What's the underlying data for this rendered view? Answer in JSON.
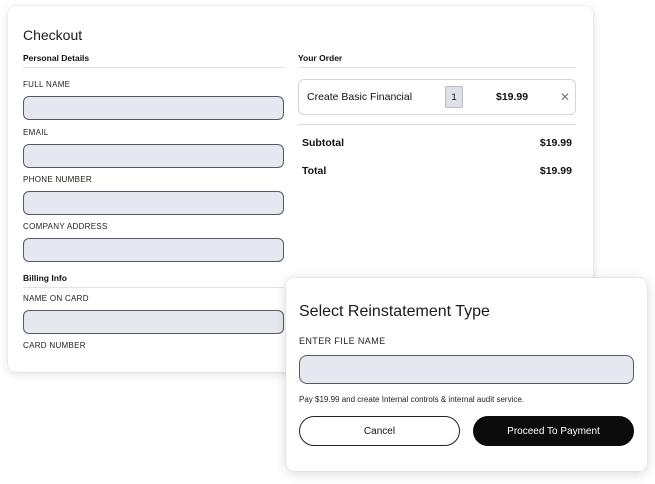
{
  "checkout": {
    "title": "Checkout",
    "personal_details": {
      "heading": "Personal Details",
      "full_name_label": "FULL NAME",
      "full_name_value": "",
      "email_label": "EMAIL",
      "email_value": "",
      "phone_label": "PHONE NUMBER",
      "phone_value": "",
      "company_address_label": "COMPANY ADDRESS",
      "company_address_value": ""
    },
    "billing_info": {
      "heading": "Billing Info",
      "name_on_card_label": "NAME ON CARD",
      "name_on_card_value": "",
      "card_number_label": "CARD NUMBER"
    },
    "order": {
      "heading": "Your Order",
      "items": [
        {
          "name": "Create Basic Financial",
          "quantity": "1",
          "price": "$19.99",
          "remove_icon": "close-icon"
        }
      ],
      "subtotal_label": "Subtotal",
      "subtotal_value": "$19.99",
      "total_label": "Total",
      "total_value": "$19.99"
    }
  },
  "modal": {
    "title": "Select Reinstatement Type",
    "file_name_label": "ENTER FILE NAME",
    "file_name_value": "",
    "note": "Pay $19.99 and create Internal controls & internal audit service.",
    "cancel_label": "Cancel",
    "proceed_label": "Proceed To Payment"
  },
  "colors": {
    "input_fill": "#e6e8ef",
    "input_border": "#555a66",
    "primary_button": "#0b0b0b"
  }
}
